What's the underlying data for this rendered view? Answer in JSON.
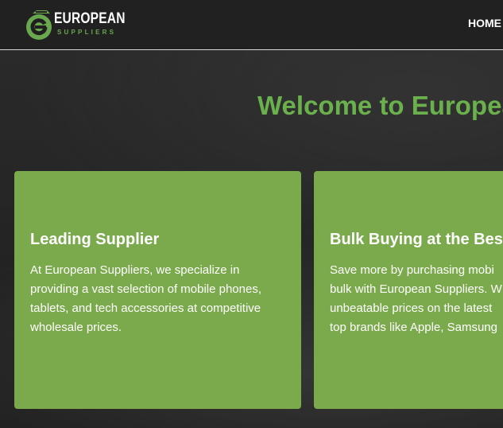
{
  "header": {
    "logo": {
      "wordmark": "EUROPEAN",
      "subtext": "SUPPLIERS",
      "icon": "bag-e-logo-icon"
    },
    "nav": {
      "home": "HOME"
    }
  },
  "hero": {
    "title": "Welcome to Europea"
  },
  "cards": [
    {
      "title": "Leading Supplier",
      "lines": [
        "At European Suppliers, we specialize in",
        "providing a vast selection of mobile phones,",
        "tablets, and tech accessories at competitive",
        "wholesale prices."
      ]
    },
    {
      "title": "Bulk Buying at the Bes",
      "lines": [
        "Save more by purchasing mobi",
        "bulk with European Suppliers. W",
        "unbeatable prices on the latest",
        "top brands like Apple, Samsung"
      ]
    }
  ],
  "colors": {
    "accent_green": "#6ab04c",
    "card_green": "#7aaa4b",
    "header_bg": "#212121",
    "text_white": "#ffffff"
  }
}
